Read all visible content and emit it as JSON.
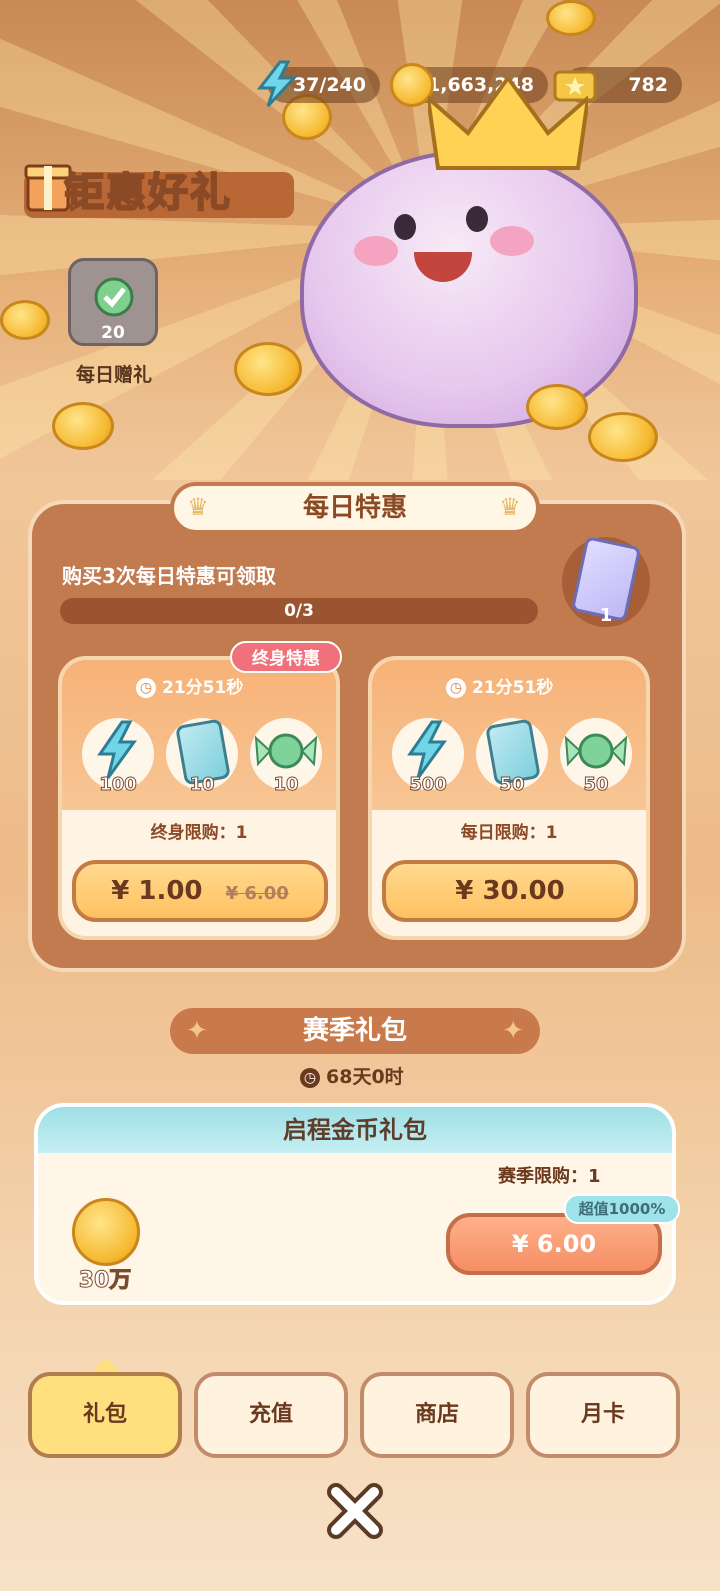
{
  "resources": {
    "energy": "37/240",
    "coins": "1,663,248",
    "tickets": "782"
  },
  "header": {
    "title": "钜惠好礼"
  },
  "daily_gift": {
    "count": "20",
    "label": "每日赠礼"
  },
  "daily_deals": {
    "title": "每日特惠",
    "progress_label": "购买3次每日特惠可领取",
    "progress_text": "0/3",
    "progress_fraction": 0.0,
    "reward_qty": "1",
    "offers": [
      {
        "tag": "终身特惠",
        "timer": "21分51秒",
        "items": [
          {
            "icon": "energy-icon",
            "qty": "100"
          },
          {
            "icon": "card-icon",
            "qty": "10"
          },
          {
            "icon": "candy-icon",
            "qty": "10"
          }
        ],
        "limit": "终身限购：1",
        "price": "¥ 1.00",
        "original_price": "¥ 6.00"
      },
      {
        "timer": "21分51秒",
        "items": [
          {
            "icon": "energy-icon",
            "qty": "500"
          },
          {
            "icon": "card-icon",
            "qty": "50"
          },
          {
            "icon": "candy-icon",
            "qty": "50"
          }
        ],
        "limit": "每日限购：1",
        "price": "¥ 30.00"
      }
    ]
  },
  "season": {
    "title": "赛季礼包",
    "timer": "68天0时",
    "pack_name": "启程金币礼包",
    "limit": "赛季限购：1",
    "badge": "超值1000%",
    "reward_qty": "30万",
    "price": "¥ 6.00"
  },
  "tabs": [
    "礼包",
    "充值",
    "商店",
    "月卡"
  ],
  "colors": {
    "accent": "#c17b4f",
    "active_tab": "#ffe07e",
    "season_head": "#9edfe6"
  }
}
